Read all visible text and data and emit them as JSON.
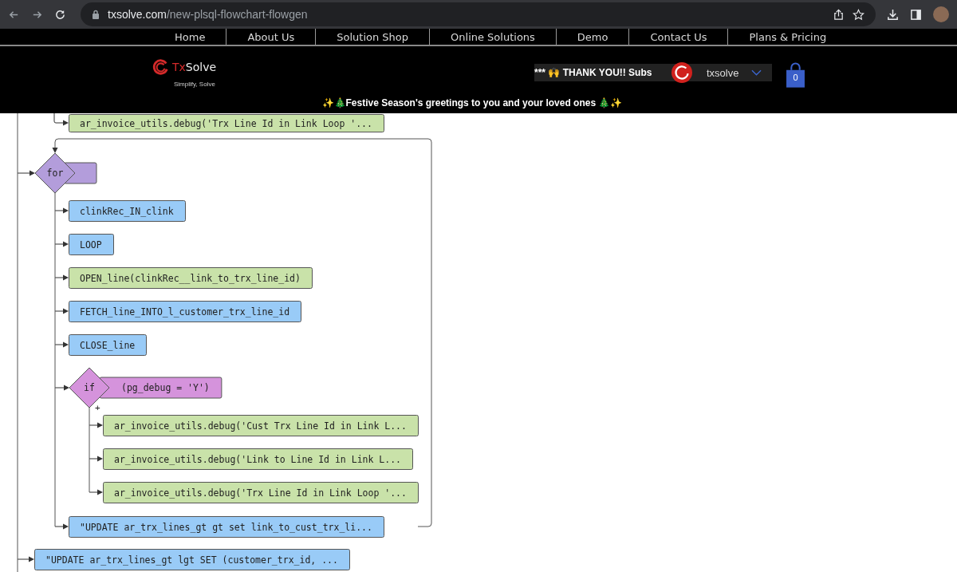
{
  "browser": {
    "url_host": "txsolve.com",
    "url_path": "/new-plsql-flowchart-flowgen"
  },
  "nav": {
    "items": [
      {
        "label": "Home"
      },
      {
        "label": "About Us"
      },
      {
        "label": "Solution Shop"
      },
      {
        "label": "Online Solutions"
      },
      {
        "label": "Demo"
      },
      {
        "label": "Contact Us"
      },
      {
        "label": "Plans & Pricing"
      }
    ]
  },
  "header": {
    "logo_prefix": "Tx",
    "logo_rest": "Solve",
    "tagline": "Simplify, Solve",
    "marquee": "*** 🙌 THANK YOU!! Subs",
    "user": "txsolve",
    "cart_count": "0",
    "greeting": "✨🎄Festive Season's greetings to you and your loved ones 🎄✨"
  },
  "flowchart": {
    "hidden_tail": {
      "text": "ar_invoice_utils.debug('Trx Line Id in Link Loop '...",
      "color": "#c9e2a9"
    },
    "steps": [
      {
        "kind": "loop",
        "label": "for",
        "color": "#b39ddb",
        "children": [
          {
            "kind": "process",
            "text": "clinkRec_IN_clink",
            "color": "#99cbf7"
          },
          {
            "kind": "process",
            "text": "LOOP",
            "color": "#99cbf7"
          },
          {
            "kind": "process",
            "text": "OPEN_line(clinkRec__link_to_trx_line_id)",
            "color": "#c9e2a9"
          },
          {
            "kind": "process",
            "text": "FETCH_line_INTO_l_customer_trx_line_id",
            "color": "#99cbf7"
          },
          {
            "kind": "process",
            "text": "CLOSE_line",
            "color": "#99cbf7"
          },
          {
            "kind": "if",
            "label": "if",
            "condition": "(pg_debug = 'Y')",
            "branch_mark": "+",
            "color": "#d593dc",
            "children": [
              {
                "kind": "process",
                "text": "ar_invoice_utils.debug('Cust Trx Line Id in Link L...",
                "color": "#c9e2a9"
              },
              {
                "kind": "process",
                "text": "ar_invoice_utils.debug('Link to Line Id in Link L...",
                "color": "#c9e2a9"
              },
              {
                "kind": "process",
                "text": "ar_invoice_utils.debug('Trx Line Id in Link Loop '...",
                "color": "#c9e2a9"
              }
            ]
          },
          {
            "kind": "process",
            "text": "\"UPDATE ar_trx_lines_gt gt set link_to_cust_trx_li...",
            "color": "#99cbf7"
          }
        ]
      },
      {
        "kind": "process",
        "text": "\"UPDATE ar_trx_lines_gt lgt SET (customer_trx_id, ...",
        "color": "#99cbf7"
      }
    ]
  }
}
